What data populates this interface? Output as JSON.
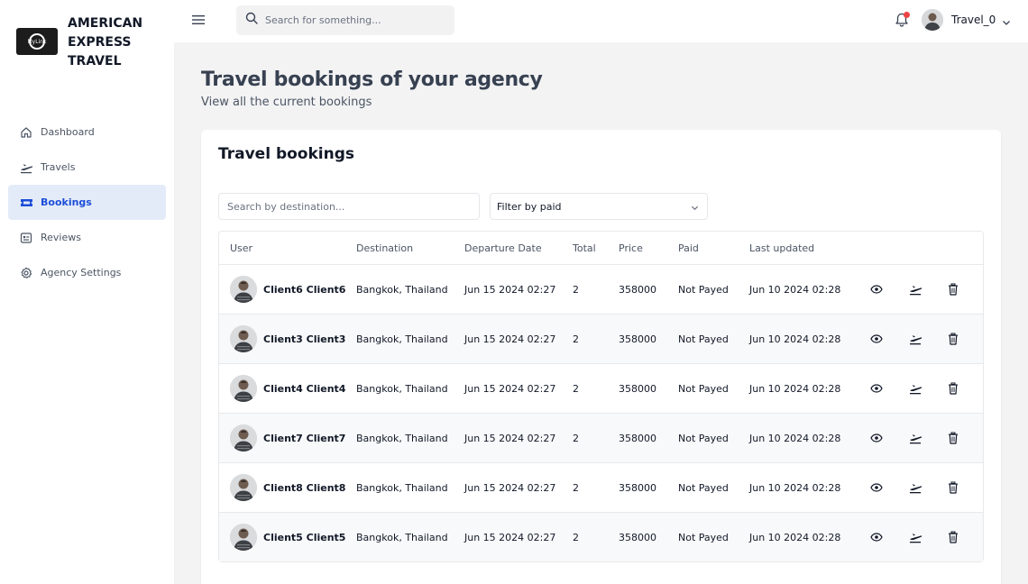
{
  "brand": {
    "name_line1": "AMERICAN",
    "name_line2": "EXPRESS",
    "name_line3": "TRAVEL",
    "logo_text": "MyLink"
  },
  "sidebar": {
    "items": [
      {
        "label": "Dashboard",
        "icon": "home-icon",
        "active": false
      },
      {
        "label": "Travels",
        "icon": "plane-takeoff-icon",
        "active": false
      },
      {
        "label": "Bookings",
        "icon": "ticket-icon",
        "active": true
      },
      {
        "label": "Reviews",
        "icon": "reviews-icon",
        "active": false
      },
      {
        "label": "Agency Settings",
        "icon": "gear-icon",
        "active": false
      }
    ]
  },
  "topbar": {
    "search_placeholder": "Search for something...",
    "user_name": "Travel_0",
    "notification_dot_color": "#ef4444"
  },
  "page": {
    "title": "Travel bookings of your agency",
    "subtitle": "View all the current bookings"
  },
  "card": {
    "title": "Travel bookings",
    "destination_placeholder": "Search by destination...",
    "filter_value": "Filter by paid"
  },
  "table": {
    "columns": [
      "User",
      "Destination",
      "Departure Date",
      "Total",
      "Price",
      "Paid",
      "Last updated"
    ],
    "rows": [
      {
        "user": "Client6 Client6",
        "destination": "Bangkok, Thailand",
        "departure": "Jun 15 2024 02:27",
        "total": "2",
        "price": "358000",
        "paid": "Not Payed",
        "updated": "Jun 10 2024 02:28"
      },
      {
        "user": "Client3 Client3",
        "destination": "Bangkok, Thailand",
        "departure": "Jun 15 2024 02:27",
        "total": "2",
        "price": "358000",
        "paid": "Not Payed",
        "updated": "Jun 10 2024 02:28"
      },
      {
        "user": "Client4 Client4",
        "destination": "Bangkok, Thailand",
        "departure": "Jun 15 2024 02:27",
        "total": "2",
        "price": "358000",
        "paid": "Not Payed",
        "updated": "Jun 10 2024 02:28"
      },
      {
        "user": "Client7 Client7",
        "destination": "Bangkok, Thailand",
        "departure": "Jun 15 2024 02:27",
        "total": "2",
        "price": "358000",
        "paid": "Not Payed",
        "updated": "Jun 10 2024 02:28"
      },
      {
        "user": "Client8 Client8",
        "destination": "Bangkok, Thailand",
        "departure": "Jun 15 2024 02:27",
        "total": "2",
        "price": "358000",
        "paid": "Not Payed",
        "updated": "Jun 10 2024 02:28"
      },
      {
        "user": "Client5 Client5",
        "destination": "Bangkok, Thailand",
        "departure": "Jun 15 2024 02:27",
        "total": "2",
        "price": "358000",
        "paid": "Not Payed",
        "updated": "Jun 10 2024 02:28"
      }
    ]
  },
  "colors": {
    "accent": "#1d4ed8",
    "active_bg": "#e3ebf8",
    "page_bg": "#f3f3f4"
  }
}
